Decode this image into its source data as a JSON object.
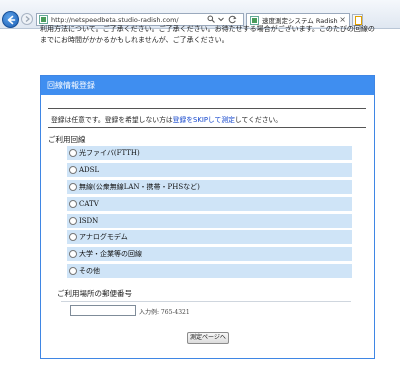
{
  "browser": {
    "url": "http://netspeedbeta.studio-radish.com/",
    "search_icon": "search-icon",
    "refresh_icon": "refresh-icon",
    "tab_title": "速度測定システム Radish Net...",
    "tab_close": "×"
  },
  "notice": {
    "line1": "利用方法について。ご了承ください。ご了承ください。お待たせする場合がございます。このたびの回線の",
    "line2": "までにお時間がかかるかもしれませんが、ご了承ください。"
  },
  "panel": {
    "header": "回線情報登録",
    "intro_before": "登録は任意です。登録を希望しない方は",
    "intro_link": "登録をSKIPして測定",
    "intro_after": "してください。",
    "section_title": "ご利用回線",
    "options": [
      "光ファイバ(FTTH)",
      "ADSL",
      "無線(公衆無線LAN・携帯・PHSなど)",
      "CATV",
      "ISDN",
      "アナログモデム",
      "大学・企業等の回線",
      "その他"
    ],
    "postal_title": "ご利用場所の郵便番号",
    "postal_value": "",
    "postal_example": "入力例: 765-4321",
    "submit_label": "測定ページへ"
  }
}
